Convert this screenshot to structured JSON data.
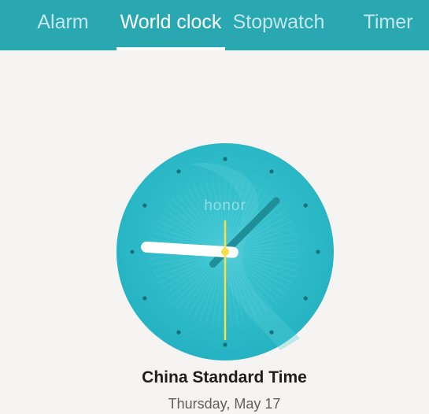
{
  "tabs": [
    {
      "label": "Alarm",
      "active": false
    },
    {
      "label": "World clock",
      "active": true
    },
    {
      "label": "Stopwatch",
      "active": false
    },
    {
      "label": "Timer",
      "active": false
    }
  ],
  "clock": {
    "brand": "honor",
    "face_color": "#2bbdcc",
    "second_hand_color": "#f5e04a",
    "hour_hand_color": "#ffffff",
    "minute_hand_color": "#1f8f97",
    "time": {
      "hour": 9,
      "minute": 7,
      "second": 30
    }
  },
  "city": {
    "name": "China Standard Time",
    "date": "Thursday, May 17"
  },
  "colors": {
    "tabbar_background": "#29a8b2",
    "page_background": "#f6f4f2"
  }
}
